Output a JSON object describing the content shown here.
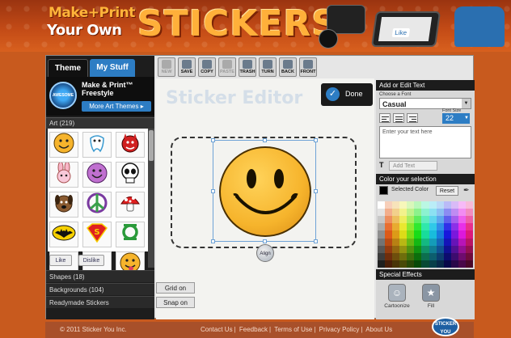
{
  "banner": {
    "brand_top": "Make+Print",
    "brand_bottom": "Your Own",
    "brand_big": "STICKERS",
    "like": "Like"
  },
  "tabs": [
    {
      "label": "Theme",
      "active": true
    },
    {
      "label": "My Stuff",
      "active": false
    }
  ],
  "theme": {
    "logo_text": "AWESOME",
    "name": "Make & Print™ Freestyle",
    "more_button": "More Art Themes ▸"
  },
  "sections": {
    "art": "Art (219)",
    "shapes": "Shapes (18)",
    "backgrounds": "Backgrounds (104)",
    "readymade": "Readymade Stickers"
  },
  "art_items": [
    {
      "icon": "smiley-icon"
    },
    {
      "icon": "tooth-icon"
    },
    {
      "icon": "devil-icon"
    },
    {
      "icon": "bunny-icon"
    },
    {
      "icon": "purple-smiley-icon"
    },
    {
      "icon": "skull-icon"
    },
    {
      "icon": "dog-icon"
    },
    {
      "icon": "peace-icon"
    },
    {
      "icon": "mushroom-icon"
    },
    {
      "icon": "batman-icon"
    },
    {
      "icon": "superman-icon"
    },
    {
      "icon": "lantern-icon"
    },
    {
      "icon": "blank-icon"
    },
    {
      "icon": "blank-icon"
    },
    {
      "icon": "tongue-smiley-icon"
    }
  ],
  "feedback": {
    "like": "Like",
    "dislike": "Dislike"
  },
  "toolbar": [
    {
      "label": "NEW",
      "icon": "new-icon",
      "disabled": true
    },
    {
      "label": "SAVE",
      "icon": "save-icon",
      "disabled": false
    },
    {
      "label": "COPY",
      "icon": "copy-icon",
      "disabled": false
    },
    {
      "label": "PASTE",
      "icon": "paste-icon",
      "disabled": true
    },
    {
      "label": "TRASH",
      "icon": "trash-icon",
      "disabled": false
    },
    {
      "label": "TURN",
      "icon": "turn-icon",
      "disabled": false
    },
    {
      "label": "BACK",
      "icon": "back-icon",
      "disabled": false
    },
    {
      "label": "FRONT",
      "icon": "front-icon",
      "disabled": false
    }
  ],
  "canvas": {
    "title": "Sticker Editor",
    "done": "Done",
    "align": "Align",
    "grid": "Grid on",
    "snap": "Snap on"
  },
  "text_panel": {
    "header": "Add or Edit Text",
    "font_label": "Choose a Font",
    "font_value": "Casual",
    "font_size_label": "Font Size",
    "font_size_value": "22",
    "placeholder": "Enter your text here",
    "add_text": "Add Text"
  },
  "color_panel": {
    "header": "Color your selection",
    "selected_color_label": "Selected Color",
    "selected_color": "#000000",
    "reset": "Reset"
  },
  "effects": {
    "header": "Special Effects",
    "items": [
      {
        "label": "Cartoonize",
        "icon": "cartoonize-icon"
      },
      {
        "label": "Fill",
        "icon": "fill-icon"
      }
    ]
  },
  "footer": {
    "copyright": "© 2011 Sticker You Inc.",
    "links": [
      "Contact Us",
      "Feedback",
      "Terms of Use",
      "Privacy Policy",
      "About Us"
    ],
    "logo": "STICKER YOU"
  }
}
